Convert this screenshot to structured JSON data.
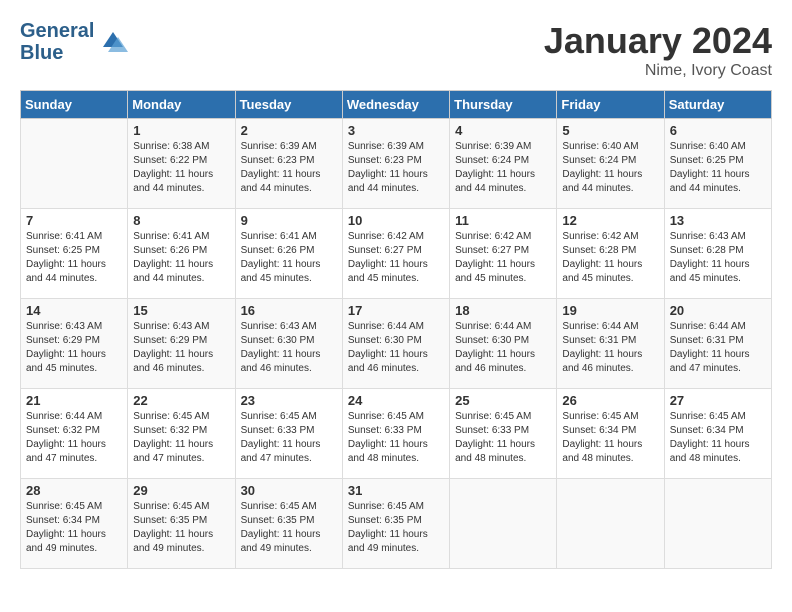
{
  "header": {
    "logo_line1": "General",
    "logo_line2": "Blue",
    "month": "January 2024",
    "location": "Nime, Ivory Coast"
  },
  "days_of_week": [
    "Sunday",
    "Monday",
    "Tuesday",
    "Wednesday",
    "Thursday",
    "Friday",
    "Saturday"
  ],
  "weeks": [
    [
      {
        "day": "",
        "sunrise": "",
        "sunset": "",
        "daylight": ""
      },
      {
        "day": "1",
        "sunrise": "Sunrise: 6:38 AM",
        "sunset": "Sunset: 6:22 PM",
        "daylight": "Daylight: 11 hours and 44 minutes."
      },
      {
        "day": "2",
        "sunrise": "Sunrise: 6:39 AM",
        "sunset": "Sunset: 6:23 PM",
        "daylight": "Daylight: 11 hours and 44 minutes."
      },
      {
        "day": "3",
        "sunrise": "Sunrise: 6:39 AM",
        "sunset": "Sunset: 6:23 PM",
        "daylight": "Daylight: 11 hours and 44 minutes."
      },
      {
        "day": "4",
        "sunrise": "Sunrise: 6:39 AM",
        "sunset": "Sunset: 6:24 PM",
        "daylight": "Daylight: 11 hours and 44 minutes."
      },
      {
        "day": "5",
        "sunrise": "Sunrise: 6:40 AM",
        "sunset": "Sunset: 6:24 PM",
        "daylight": "Daylight: 11 hours and 44 minutes."
      },
      {
        "day": "6",
        "sunrise": "Sunrise: 6:40 AM",
        "sunset": "Sunset: 6:25 PM",
        "daylight": "Daylight: 11 hours and 44 minutes."
      }
    ],
    [
      {
        "day": "7",
        "sunrise": "Sunrise: 6:41 AM",
        "sunset": "Sunset: 6:25 PM",
        "daylight": "Daylight: 11 hours and 44 minutes."
      },
      {
        "day": "8",
        "sunrise": "Sunrise: 6:41 AM",
        "sunset": "Sunset: 6:26 PM",
        "daylight": "Daylight: 11 hours and 44 minutes."
      },
      {
        "day": "9",
        "sunrise": "Sunrise: 6:41 AM",
        "sunset": "Sunset: 6:26 PM",
        "daylight": "Daylight: 11 hours and 45 minutes."
      },
      {
        "day": "10",
        "sunrise": "Sunrise: 6:42 AM",
        "sunset": "Sunset: 6:27 PM",
        "daylight": "Daylight: 11 hours and 45 minutes."
      },
      {
        "day": "11",
        "sunrise": "Sunrise: 6:42 AM",
        "sunset": "Sunset: 6:27 PM",
        "daylight": "Daylight: 11 hours and 45 minutes."
      },
      {
        "day": "12",
        "sunrise": "Sunrise: 6:42 AM",
        "sunset": "Sunset: 6:28 PM",
        "daylight": "Daylight: 11 hours and 45 minutes."
      },
      {
        "day": "13",
        "sunrise": "Sunrise: 6:43 AM",
        "sunset": "Sunset: 6:28 PM",
        "daylight": "Daylight: 11 hours and 45 minutes."
      }
    ],
    [
      {
        "day": "14",
        "sunrise": "Sunrise: 6:43 AM",
        "sunset": "Sunset: 6:29 PM",
        "daylight": "Daylight: 11 hours and 45 minutes."
      },
      {
        "day": "15",
        "sunrise": "Sunrise: 6:43 AM",
        "sunset": "Sunset: 6:29 PM",
        "daylight": "Daylight: 11 hours and 46 minutes."
      },
      {
        "day": "16",
        "sunrise": "Sunrise: 6:43 AM",
        "sunset": "Sunset: 6:30 PM",
        "daylight": "Daylight: 11 hours and 46 minutes."
      },
      {
        "day": "17",
        "sunrise": "Sunrise: 6:44 AM",
        "sunset": "Sunset: 6:30 PM",
        "daylight": "Daylight: 11 hours and 46 minutes."
      },
      {
        "day": "18",
        "sunrise": "Sunrise: 6:44 AM",
        "sunset": "Sunset: 6:30 PM",
        "daylight": "Daylight: 11 hours and 46 minutes."
      },
      {
        "day": "19",
        "sunrise": "Sunrise: 6:44 AM",
        "sunset": "Sunset: 6:31 PM",
        "daylight": "Daylight: 11 hours and 46 minutes."
      },
      {
        "day": "20",
        "sunrise": "Sunrise: 6:44 AM",
        "sunset": "Sunset: 6:31 PM",
        "daylight": "Daylight: 11 hours and 47 minutes."
      }
    ],
    [
      {
        "day": "21",
        "sunrise": "Sunrise: 6:44 AM",
        "sunset": "Sunset: 6:32 PM",
        "daylight": "Daylight: 11 hours and 47 minutes."
      },
      {
        "day": "22",
        "sunrise": "Sunrise: 6:45 AM",
        "sunset": "Sunset: 6:32 PM",
        "daylight": "Daylight: 11 hours and 47 minutes."
      },
      {
        "day": "23",
        "sunrise": "Sunrise: 6:45 AM",
        "sunset": "Sunset: 6:33 PM",
        "daylight": "Daylight: 11 hours and 47 minutes."
      },
      {
        "day": "24",
        "sunrise": "Sunrise: 6:45 AM",
        "sunset": "Sunset: 6:33 PM",
        "daylight": "Daylight: 11 hours and 48 minutes."
      },
      {
        "day": "25",
        "sunrise": "Sunrise: 6:45 AM",
        "sunset": "Sunset: 6:33 PM",
        "daylight": "Daylight: 11 hours and 48 minutes."
      },
      {
        "day": "26",
        "sunrise": "Sunrise: 6:45 AM",
        "sunset": "Sunset: 6:34 PM",
        "daylight": "Daylight: 11 hours and 48 minutes."
      },
      {
        "day": "27",
        "sunrise": "Sunrise: 6:45 AM",
        "sunset": "Sunset: 6:34 PM",
        "daylight": "Daylight: 11 hours and 48 minutes."
      }
    ],
    [
      {
        "day": "28",
        "sunrise": "Sunrise: 6:45 AM",
        "sunset": "Sunset: 6:34 PM",
        "daylight": "Daylight: 11 hours and 49 minutes."
      },
      {
        "day": "29",
        "sunrise": "Sunrise: 6:45 AM",
        "sunset": "Sunset: 6:35 PM",
        "daylight": "Daylight: 11 hours and 49 minutes."
      },
      {
        "day": "30",
        "sunrise": "Sunrise: 6:45 AM",
        "sunset": "Sunset: 6:35 PM",
        "daylight": "Daylight: 11 hours and 49 minutes."
      },
      {
        "day": "31",
        "sunrise": "Sunrise: 6:45 AM",
        "sunset": "Sunset: 6:35 PM",
        "daylight": "Daylight: 11 hours and 49 minutes."
      },
      {
        "day": "",
        "sunrise": "",
        "sunset": "",
        "daylight": ""
      },
      {
        "day": "",
        "sunrise": "",
        "sunset": "",
        "daylight": ""
      },
      {
        "day": "",
        "sunrise": "",
        "sunset": "",
        "daylight": ""
      }
    ]
  ]
}
